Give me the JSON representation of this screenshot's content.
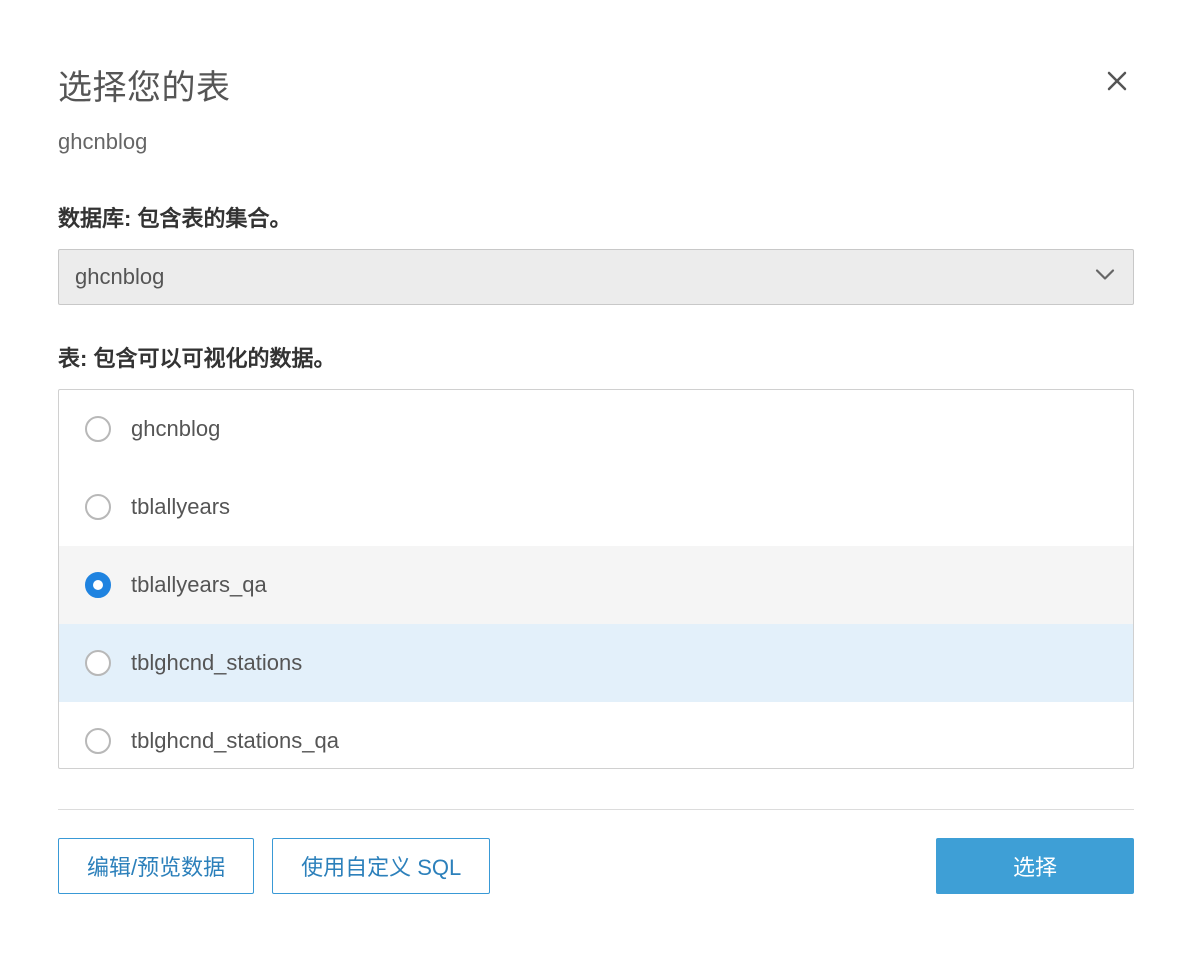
{
  "dialog": {
    "title": "选择您的表",
    "subtitle": "ghcnblog"
  },
  "database": {
    "label": "数据库: 包含表的集合。",
    "selected": "ghcnblog"
  },
  "tables": {
    "label": "表: 包含可以可视化的数据。",
    "items": [
      {
        "name": "ghcnblog",
        "selected": false,
        "state": "normal"
      },
      {
        "name": "tblallyears",
        "selected": false,
        "state": "normal"
      },
      {
        "name": "tblallyears_qa",
        "selected": true,
        "state": "selected"
      },
      {
        "name": "tblghcnd_stations",
        "selected": false,
        "state": "hover"
      },
      {
        "name": "tblghcnd_stations_qa",
        "selected": false,
        "state": "normal"
      }
    ]
  },
  "footer": {
    "edit_preview": "编辑/预览数据",
    "custom_sql": "使用自定义 SQL",
    "select": "选择"
  }
}
